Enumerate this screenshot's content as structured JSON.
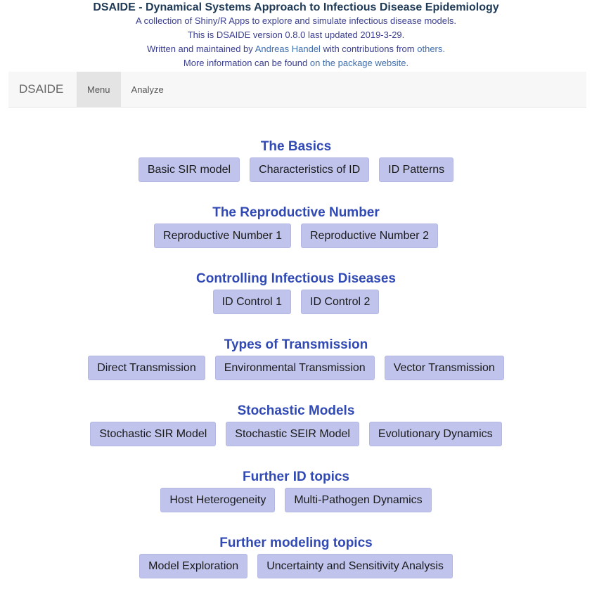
{
  "header": {
    "title": "DSAIDE - Dynamical Systems Approach to Infectious Disease Epidemiology",
    "line1": "A collection of Shiny/R Apps to explore and simulate infectious disease models.",
    "line2": "This is DSAIDE version 0.8.0 last updated 2019-3-29.",
    "line3_prefix": "Written and maintained by",
    "line3_author": "Andreas Handel",
    "line3_middle": "with contributions from",
    "line3_others": "others.",
    "line4_prefix": "More information can be found",
    "line4_link": "on the package website."
  },
  "navbar": {
    "brand": "DSAIDE",
    "tabs": [
      {
        "label": "Menu",
        "active": true
      },
      {
        "label": "Analyze",
        "active": false
      }
    ]
  },
  "sections": [
    {
      "heading": "The Basics",
      "buttons": [
        "Basic SIR model",
        "Characteristics of ID",
        "ID Patterns"
      ]
    },
    {
      "heading": "The Reproductive Number",
      "buttons": [
        "Reproductive Number 1",
        "Reproductive Number 2"
      ]
    },
    {
      "heading": "Controlling Infectious Diseases",
      "buttons": [
        "ID Control 1",
        "ID Control 2"
      ]
    },
    {
      "heading": "Types of Transmission",
      "buttons": [
        "Direct Transmission",
        "Environmental Transmission",
        "Vector Transmission"
      ]
    },
    {
      "heading": "Stochastic Models",
      "buttons": [
        "Stochastic SIR Model",
        "Stochastic SEIR Model",
        "Evolutionary Dynamics"
      ]
    },
    {
      "heading": "Further ID topics",
      "buttons": [
        "Host Heterogeneity",
        "Multi-Pathogen Dynamics"
      ]
    },
    {
      "heading": "Further modeling topics",
      "buttons": [
        "Model Exploration",
        "Uncertainty and Sensitivity Analysis"
      ]
    }
  ],
  "colors": {
    "heading": "#3049b5",
    "button_bg": "#c0c4ec",
    "title": "#1f3a56",
    "link": "#3f6eae"
  }
}
